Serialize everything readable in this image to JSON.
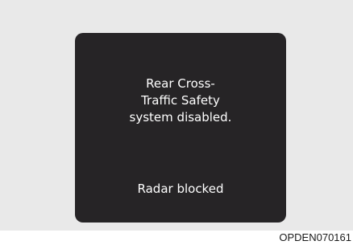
{
  "display": {
    "message_lines": [
      "Rear Cross-",
      "Traffic Safety",
      "system disabled."
    ],
    "status": "Radar blocked"
  },
  "caption": "OPDEN070161",
  "colors": {
    "screen_background": "#262426",
    "frame_background": "#e9e9e9",
    "text": "#ffffff"
  }
}
